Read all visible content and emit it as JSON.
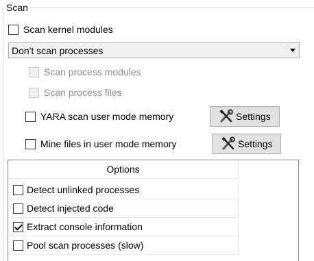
{
  "group": {
    "title": "Scan"
  },
  "scan_kernel_modules": {
    "label": "Scan kernel modules",
    "checked": false
  },
  "process_mode": {
    "selected": "Don't scan processes"
  },
  "scan_process_modules": {
    "label": "Scan process modules",
    "checked": false,
    "enabled": false
  },
  "scan_process_files": {
    "label": "Scan process files",
    "checked": false,
    "enabled": false
  },
  "yara": {
    "label": "YARA scan user mode memory",
    "checked": false,
    "settings_label": "Settings"
  },
  "mine_files": {
    "label": "Mine files in user mode memory",
    "checked": false,
    "settings_label": "Settings"
  },
  "options": {
    "header": "Options",
    "items": [
      {
        "label": "Detect unlinked processes",
        "checked": false
      },
      {
        "label": "Detect injected code",
        "checked": false
      },
      {
        "label": "Extract console information",
        "checked": true
      },
      {
        "label": "Pool scan processes (slow)",
        "checked": false
      }
    ]
  },
  "icons": {
    "settings_button_icon": "tools-icon"
  },
  "colors": {
    "button_bg": "#e1e1e1",
    "combo_bg": "#f0f0f0",
    "disabled_text": "#8c8c8c",
    "list_border": "#828790"
  }
}
